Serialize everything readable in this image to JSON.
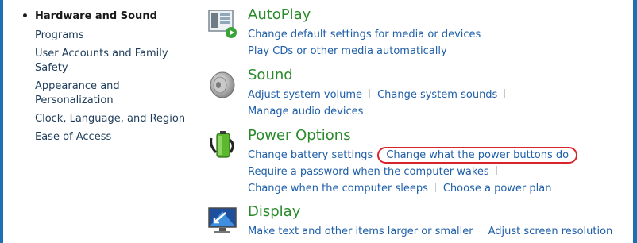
{
  "nav": {
    "current": "Hardware and Sound",
    "items": [
      "Programs",
      "User Accounts and Family Safety",
      "Appearance and Personalization",
      "Clock, Language, and Region",
      "Ease of Access"
    ]
  },
  "categories": [
    {
      "title": "AutoPlay",
      "icon": "autoplay-icon",
      "links": [
        "Change default settings for media or devices",
        "Play CDs or other media automatically"
      ]
    },
    {
      "title": "Sound",
      "icon": "speaker-icon",
      "links": [
        "Adjust system volume",
        "Change system sounds",
        "Manage audio devices"
      ]
    },
    {
      "title": "Power Options",
      "icon": "battery-icon",
      "links": [
        "Change battery settings",
        "Change what the power buttons do",
        "Require a password when the computer wakes",
        "Change when the computer sleeps",
        "Choose a power plan"
      ]
    },
    {
      "title": "Display",
      "icon": "monitor-icon",
      "links": [
        "Make text and other items larger or smaller",
        "Adjust screen resolution"
      ]
    }
  ],
  "colors": {
    "frame": "#1f6fb4",
    "link": "#1f5fa8",
    "title": "#2a8a2a",
    "highlight": "#d8242b"
  }
}
